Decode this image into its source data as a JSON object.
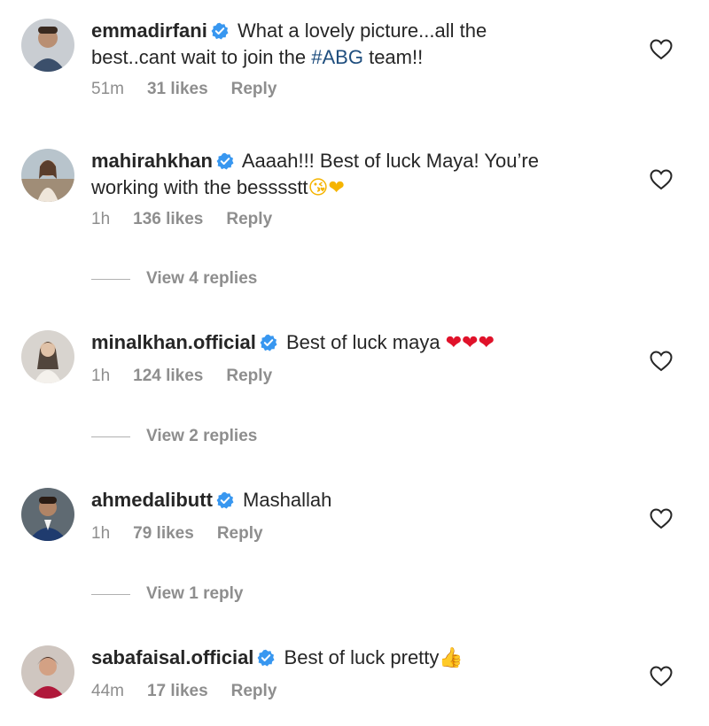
{
  "comments": [
    {
      "username": "emmadirfani",
      "text_pre": "What a lovely picture...all the",
      "text_line2": "best..cant wait to join the ",
      "hashtag": "#ABG",
      "text_post": " team!!",
      "time": "51m",
      "likes": "31 likes",
      "reply": "Reply"
    },
    {
      "username": "mahirahkhan",
      "text_pre": "Aaaah!!! Best of luck Maya! You’re",
      "text_line2": "working with the besssstt",
      "emoji": "😘❤",
      "time": "1h",
      "likes": "136 likes",
      "reply": "Reply",
      "view_replies": "View 4 replies"
    },
    {
      "username": "minalkhan.official",
      "text_pre": "Best of luck maya ",
      "emoji": "❤❤❤",
      "time": "1h",
      "likes": "124 likes",
      "reply": "Reply",
      "view_replies": "View 2 replies"
    },
    {
      "username": "ahmedalibutt",
      "text_pre": "Mashallah",
      "time": "1h",
      "likes": "79 likes",
      "reply": "Reply",
      "view_replies": "View 1 reply"
    },
    {
      "username": "sabafaisal.official",
      "text_pre": "Best of luck pretty",
      "emoji": "👍",
      "time": "44m",
      "likes": "17 likes",
      "reply": "Reply"
    }
  ],
  "icons": {
    "verified": "verified-badge-icon",
    "like": "heart-outline-icon"
  },
  "colors": {
    "verified": "#3897f0",
    "hashtag": "#1f4e7e",
    "meta": "#8e8e8e"
  }
}
